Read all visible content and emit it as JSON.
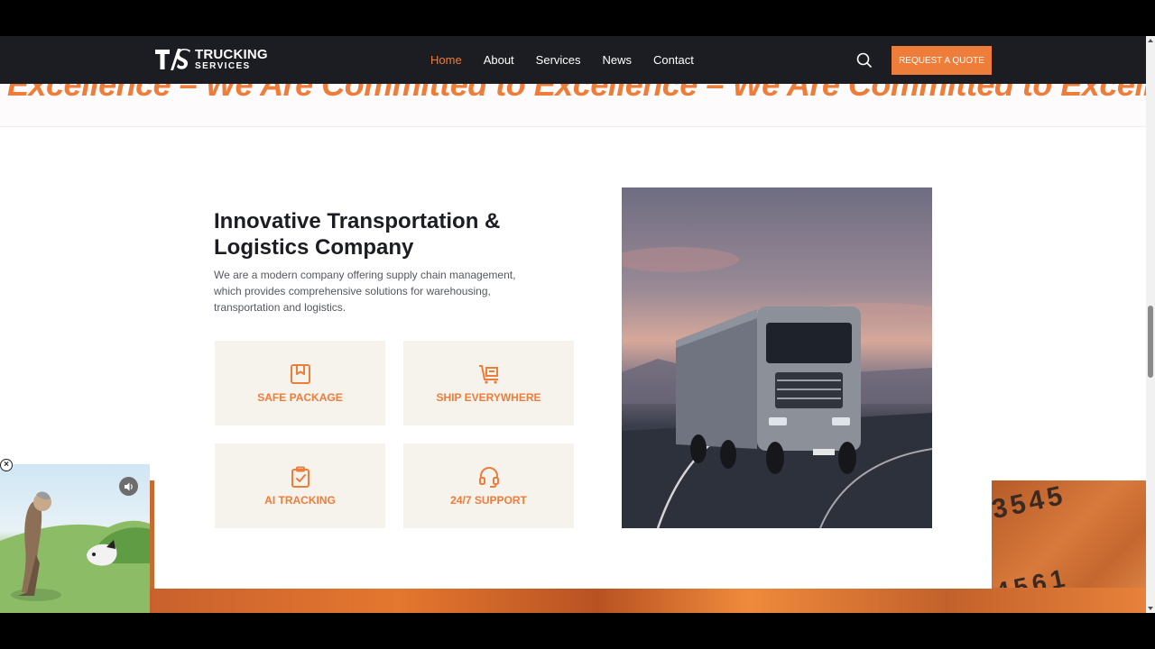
{
  "header": {
    "logo_mark": "T/S",
    "logo_line1": "TRUCKING",
    "logo_line2": "SERVICES",
    "nav": [
      {
        "label": "Home",
        "active": true
      },
      {
        "label": "About",
        "active": false
      },
      {
        "label": "Services",
        "active": false
      },
      {
        "label": "News",
        "active": false
      },
      {
        "label": "Contact",
        "active": false
      }
    ],
    "quote_button": "REQUEST A QUOTE"
  },
  "marquee": {
    "text": "Excellence – We Are Committed to Excellence – We Are Committed to Excellence"
  },
  "intro": {
    "title": "Innovative Transportation & Logistics Company",
    "description": "We are a modern company offering supply chain management, which provides comprehensive solutions for warehousing, transportation and logistics."
  },
  "features": [
    {
      "label": "SAFE PACKAGE",
      "icon": "package-icon"
    },
    {
      "label": "SHIP EVERYWHERE",
      "icon": "truck-icon"
    },
    {
      "label": "AI TRACKING",
      "icon": "clipboard-check-icon"
    },
    {
      "label": "24/7 SUPPORT",
      "icon": "headset-icon"
    }
  ],
  "colors": {
    "accent": "#ee7d3a",
    "header_bg": "#1c1d22",
    "feature_bg": "#f6f2ec"
  },
  "background": {
    "container_number_top": "3545",
    "container_number_bottom": "4561"
  }
}
